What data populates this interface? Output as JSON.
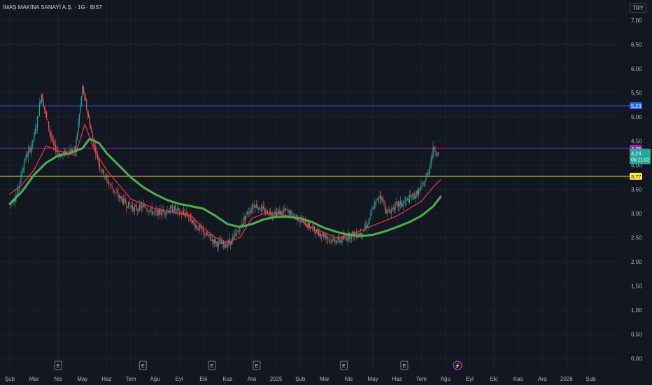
{
  "header": {
    "title": "İMAŞ MAKİNA SANAYİ A.Ş. · 1G · BIST",
    "currency": "TRY"
  },
  "chart_data": {
    "type": "candlestick",
    "title": "İMAŞ MAKİNA SANAYİ A.Ş. · 1G · BIST",
    "xlabel": "",
    "ylabel": "",
    "ylim": [
      0,
      7
    ],
    "grid": true,
    "y_ticks": [
      "0,00",
      "0,50",
      "1,00",
      "1,50",
      "2,00",
      "2,50",
      "3,00",
      "3,50",
      "4,00",
      "4,50",
      "5,00",
      "5,50",
      "6,00",
      "6,50",
      "7,00"
    ],
    "x_ticks": [
      "Şub",
      "Mar",
      "Nis",
      "May",
      "Haz",
      "Tem",
      "Ağu",
      "Eyl",
      "Eki",
      "Kas",
      "Ara",
      "2025",
      "Şub",
      "Mar",
      "Nis",
      "May",
      "Haz",
      "Tem",
      "Ağu",
      "Eyl",
      "Eki",
      "Kas",
      "Ara",
      "2026",
      "Şub"
    ],
    "price_path": [
      [
        0,
        3.2
      ],
      [
        0.3,
        3.4
      ],
      [
        0.6,
        4.1
      ],
      [
        0.9,
        4.4
      ],
      [
        1.1,
        4.8
      ],
      [
        1.3,
        5.5
      ],
      [
        1.5,
        5.0
      ],
      [
        1.8,
        4.4
      ],
      [
        2.1,
        4.2
      ],
      [
        2.4,
        4.3
      ],
      [
        2.7,
        4.3
      ],
      [
        3.0,
        5.6
      ],
      [
        3.2,
        5.1
      ],
      [
        3.4,
        4.6
      ],
      [
        3.7,
        4.0
      ],
      [
        4.0,
        3.7
      ],
      [
        4.4,
        3.4
      ],
      [
        4.8,
        3.2
      ],
      [
        5.2,
        3.1
      ],
      [
        5.6,
        3.15
      ],
      [
        6.0,
        3.0
      ],
      [
        6.4,
        3.05
      ],
      [
        6.8,
        3.1
      ],
      [
        7.0,
        3.0
      ],
      [
        7.3,
        3.0
      ],
      [
        7.6,
        2.8
      ],
      [
        8.0,
        2.6
      ],
      [
        8.5,
        2.4
      ],
      [
        8.9,
        2.35
      ],
      [
        9.2,
        2.45
      ],
      [
        9.5,
        2.7
      ],
      [
        9.8,
        3.0
      ],
      [
        10.1,
        3.2
      ],
      [
        10.5,
        3.05
      ],
      [
        11.0,
        3.0
      ],
      [
        11.4,
        3.05
      ],
      [
        11.8,
        2.95
      ],
      [
        12.2,
        2.8
      ],
      [
        12.6,
        2.65
      ],
      [
        13.0,
        2.55
      ],
      [
        13.3,
        2.45
      ],
      [
        13.7,
        2.45
      ],
      [
        14.0,
        2.55
      ],
      [
        14.5,
        2.6
      ],
      [
        14.8,
        2.8
      ],
      [
        15.0,
        3.1
      ],
      [
        15.3,
        3.4
      ],
      [
        15.6,
        3.0
      ],
      [
        15.9,
        3.15
      ],
      [
        16.2,
        3.2
      ],
      [
        16.5,
        3.3
      ],
      [
        16.8,
        3.4
      ],
      [
        17.1,
        3.6
      ],
      [
        17.3,
        3.9
      ],
      [
        17.5,
        4.35
      ],
      [
        17.7,
        4.24
      ]
    ],
    "series": [
      {
        "name": "",
        "type": "line",
        "color": "#f23645",
        "points": [
          [
            0,
            3.4
          ],
          [
            0.5,
            3.6
          ],
          [
            1.0,
            3.9
          ],
          [
            1.5,
            4.4
          ],
          [
            2.0,
            4.3
          ],
          [
            2.7,
            4.2
          ],
          [
            3.1,
            4.85
          ],
          [
            3.5,
            4.3
          ],
          [
            4.0,
            3.9
          ],
          [
            4.5,
            3.6
          ],
          [
            5.0,
            3.3
          ],
          [
            5.5,
            3.2
          ],
          [
            6.0,
            3.1
          ],
          [
            6.5,
            3.05
          ],
          [
            7.0,
            3.0
          ],
          [
            7.5,
            2.95
          ],
          [
            8.0,
            2.7
          ],
          [
            8.5,
            2.5
          ],
          [
            9.0,
            2.4
          ],
          [
            9.5,
            2.5
          ],
          [
            10.0,
            2.9
          ],
          [
            10.5,
            3.0
          ],
          [
            11.0,
            3.0
          ],
          [
            11.5,
            2.95
          ],
          [
            12.0,
            2.85
          ],
          [
            12.5,
            2.7
          ],
          [
            13.0,
            2.6
          ],
          [
            13.5,
            2.5
          ],
          [
            14.0,
            2.55
          ],
          [
            14.5,
            2.65
          ],
          [
            15.0,
            2.75
          ],
          [
            15.5,
            2.85
          ],
          [
            16.0,
            2.95
          ],
          [
            16.5,
            3.1
          ],
          [
            17.0,
            3.25
          ],
          [
            17.5,
            3.55
          ],
          [
            17.8,
            3.7
          ]
        ]
      },
      {
        "name": "",
        "type": "line",
        "color": "#4caf50",
        "points": [
          [
            0,
            3.2
          ],
          [
            0.5,
            3.45
          ],
          [
            1.0,
            3.8
          ],
          [
            1.5,
            4.05
          ],
          [
            2.0,
            4.2
          ],
          [
            2.5,
            4.25
          ],
          [
            3.0,
            4.35
          ],
          [
            3.3,
            4.55
          ],
          [
            3.7,
            4.45
          ],
          [
            4.0,
            4.25
          ],
          [
            4.5,
            4.0
          ],
          [
            5.0,
            3.75
          ],
          [
            5.5,
            3.55
          ],
          [
            6.0,
            3.4
          ],
          [
            6.5,
            3.28
          ],
          [
            7.0,
            3.2
          ],
          [
            7.5,
            3.15
          ],
          [
            8.0,
            3.1
          ],
          [
            8.5,
            2.95
          ],
          [
            9.0,
            2.78
          ],
          [
            9.5,
            2.72
          ],
          [
            10.0,
            2.78
          ],
          [
            10.5,
            2.88
          ],
          [
            11.0,
            2.93
          ],
          [
            11.5,
            2.93
          ],
          [
            12.0,
            2.9
          ],
          [
            12.5,
            2.82
          ],
          [
            13.0,
            2.7
          ],
          [
            13.5,
            2.62
          ],
          [
            14.0,
            2.56
          ],
          [
            14.5,
            2.53
          ],
          [
            15.0,
            2.56
          ],
          [
            15.5,
            2.63
          ],
          [
            16.0,
            2.72
          ],
          [
            16.5,
            2.82
          ],
          [
            17.0,
            2.95
          ],
          [
            17.5,
            3.15
          ],
          [
            17.8,
            3.35
          ]
        ]
      }
    ],
    "horizontal_levels": [
      {
        "label": "5,23",
        "value": 5.23,
        "color": "#2962ff"
      },
      {
        "label": "4,35",
        "value": 4.35,
        "color": "#9c27b0"
      },
      {
        "label": "3,77",
        "value": 3.77,
        "color": "#ffeb3b"
      }
    ],
    "last_price": {
      "value": 4.24,
      "label": "4,24",
      "countdown": "05:11:02",
      "color": "#26a69a"
    },
    "event_markers": [
      {
        "label": "E",
        "x": 2.0
      },
      {
        "label": "E",
        "x": 5.5
      },
      {
        "label": "E",
        "x": 8.35
      },
      {
        "label": "E",
        "x": 10.2
      },
      {
        "label": "E",
        "x": 13.8
      },
      {
        "label": "E",
        "x": 16.3
      },
      {
        "label": "⚡",
        "x": 18.5
      }
    ]
  }
}
